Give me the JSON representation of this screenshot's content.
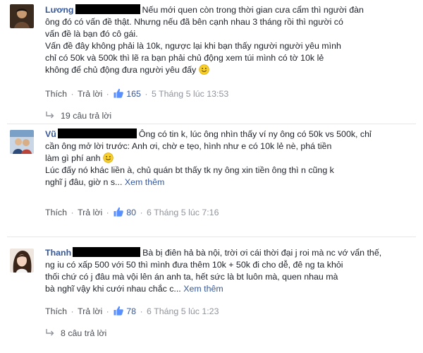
{
  "comments": [
    {
      "name": "Lương",
      "text_after_name": "Nếu mới quen còn trong thời gian cưa cẩm thì người đàn",
      "lines": [
        "ông đó có vấn đề thật. Nhưng nếu đã bên cạnh nhau 3 tháng rồi thì người có",
        "vấn đề là bạn đó cô gái.",
        "Vấn đề đây không phải là 10k, ngược lại khi bạn thấy người người yêu mình",
        "chỉ có 50k và 500k thì lẽ ra bạn phải chủ động xem túi mình có tờ 10k lẻ",
        "không để chủ động đưa người yêu đấy"
      ],
      "like_label": "Thích",
      "reply_label": "Trả lời",
      "like_count": "165",
      "date": "5 Tháng 5 lúc 13:53",
      "replies_label": "19 câu trả lời"
    },
    {
      "name": "Vũ",
      "text_after_name": "Ông có tin k, lúc ông nhìn thấy ví ny ông có 50k vs 500k, chỉ",
      "lines": [
        "cần ông mở lời trước: Anh ơi, chờ e tẹo, hình như e có 10k lẻ nè, phá tiền",
        "làm gì phí anh",
        "Lúc đấy nó khác liền à, chủ quán bt thấy tk ny ông xin tiền ông thì n cũng k",
        "nghĩ j đâu, giờ n s..."
      ],
      "see_more": "Xem thêm",
      "like_label": "Thích",
      "reply_label": "Trả lời",
      "like_count": "80",
      "date": "6 Tháng 5 lúc 7:16"
    },
    {
      "name": "Thanh",
      "text_after_name": "Bà bị điên hả bà nội, trời ơi cái thời đại j roi mà nc vớ vẩn thế,",
      "lines": [
        "ng iu có xấp 500 với 50 thì mình đưa thêm 10k + 50k đi cho dễ, đê ng ta khỏi",
        "thối chứ có j đâu mà vội lên án anh ta, hết sức là bt luôn mà, quen nhau mà",
        "bà nghĩ vậy khi cưới nhau chắc c..."
      ],
      "see_more": "Xem thêm",
      "like_label": "Thích",
      "reply_label": "Trả lời",
      "like_count": "78",
      "date": "6 Tháng 5 lúc 1:23",
      "replies_label": "8 câu trả lời"
    }
  ],
  "colors": {
    "link": "#365899",
    "meta": "#90949c",
    "text": "#1d2129",
    "redaction": "#000000"
  },
  "icons": [
    "like-thumb-icon",
    "reply-arrow-icon",
    "smile-emoji-icon"
  ]
}
